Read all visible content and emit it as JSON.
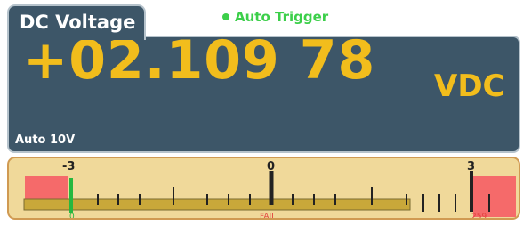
{
  "mode_tab": {
    "label": "DC Voltage"
  },
  "trigger": {
    "label": "Auto Trigger",
    "color": "#3ccf4a"
  },
  "display": {
    "reading": "+02.109 78",
    "unit": "VDC",
    "range": "Auto 10V",
    "text_color": "#f2bd1c",
    "background": "#3d5668"
  },
  "bar_meter": {
    "scale_labels": [
      "-3",
      "0",
      "3"
    ],
    "min": -3,
    "max": 3,
    "limit_low_count": "0",
    "limit_status": "FAIL",
    "limit_high_count": "259",
    "colors": {
      "limit_zone": "#f56a6a",
      "bar": "#c9a83a",
      "marker": "#27b83f",
      "fail_text": "#e3423f"
    }
  },
  "icons": {
    "trigger_indicator": "green-dot"
  }
}
